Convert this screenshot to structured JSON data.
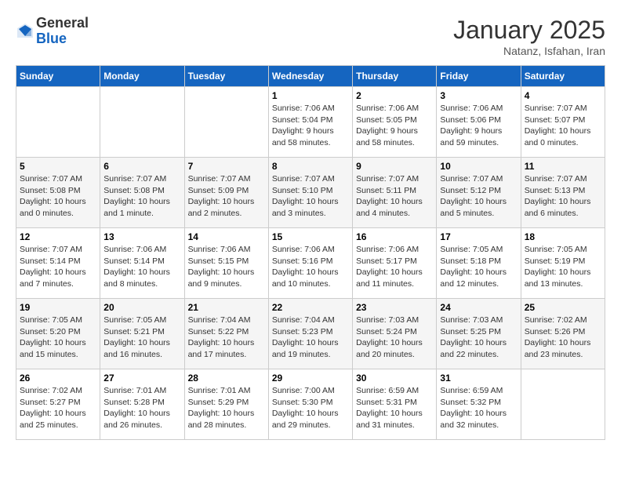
{
  "header": {
    "logo_general": "General",
    "logo_blue": "Blue",
    "month_title": "January 2025",
    "subtitle": "Natanz, Isfahan, Iran"
  },
  "days_of_week": [
    "Sunday",
    "Monday",
    "Tuesday",
    "Wednesday",
    "Thursday",
    "Friday",
    "Saturday"
  ],
  "weeks": [
    [
      {
        "day": "",
        "info": ""
      },
      {
        "day": "",
        "info": ""
      },
      {
        "day": "",
        "info": ""
      },
      {
        "day": "1",
        "info": "Sunrise: 7:06 AM\nSunset: 5:04 PM\nDaylight: 9 hours\nand 58 minutes."
      },
      {
        "day": "2",
        "info": "Sunrise: 7:06 AM\nSunset: 5:05 PM\nDaylight: 9 hours\nand 58 minutes."
      },
      {
        "day": "3",
        "info": "Sunrise: 7:06 AM\nSunset: 5:06 PM\nDaylight: 9 hours\nand 59 minutes."
      },
      {
        "day": "4",
        "info": "Sunrise: 7:07 AM\nSunset: 5:07 PM\nDaylight: 10 hours\nand 0 minutes."
      }
    ],
    [
      {
        "day": "5",
        "info": "Sunrise: 7:07 AM\nSunset: 5:08 PM\nDaylight: 10 hours\nand 0 minutes."
      },
      {
        "day": "6",
        "info": "Sunrise: 7:07 AM\nSunset: 5:08 PM\nDaylight: 10 hours\nand 1 minute."
      },
      {
        "day": "7",
        "info": "Sunrise: 7:07 AM\nSunset: 5:09 PM\nDaylight: 10 hours\nand 2 minutes."
      },
      {
        "day": "8",
        "info": "Sunrise: 7:07 AM\nSunset: 5:10 PM\nDaylight: 10 hours\nand 3 minutes."
      },
      {
        "day": "9",
        "info": "Sunrise: 7:07 AM\nSunset: 5:11 PM\nDaylight: 10 hours\nand 4 minutes."
      },
      {
        "day": "10",
        "info": "Sunrise: 7:07 AM\nSunset: 5:12 PM\nDaylight: 10 hours\nand 5 minutes."
      },
      {
        "day": "11",
        "info": "Sunrise: 7:07 AM\nSunset: 5:13 PM\nDaylight: 10 hours\nand 6 minutes."
      }
    ],
    [
      {
        "day": "12",
        "info": "Sunrise: 7:07 AM\nSunset: 5:14 PM\nDaylight: 10 hours\nand 7 minutes."
      },
      {
        "day": "13",
        "info": "Sunrise: 7:06 AM\nSunset: 5:14 PM\nDaylight: 10 hours\nand 8 minutes."
      },
      {
        "day": "14",
        "info": "Sunrise: 7:06 AM\nSunset: 5:15 PM\nDaylight: 10 hours\nand 9 minutes."
      },
      {
        "day": "15",
        "info": "Sunrise: 7:06 AM\nSunset: 5:16 PM\nDaylight: 10 hours\nand 10 minutes."
      },
      {
        "day": "16",
        "info": "Sunrise: 7:06 AM\nSunset: 5:17 PM\nDaylight: 10 hours\nand 11 minutes."
      },
      {
        "day": "17",
        "info": "Sunrise: 7:05 AM\nSunset: 5:18 PM\nDaylight: 10 hours\nand 12 minutes."
      },
      {
        "day": "18",
        "info": "Sunrise: 7:05 AM\nSunset: 5:19 PM\nDaylight: 10 hours\nand 13 minutes."
      }
    ],
    [
      {
        "day": "19",
        "info": "Sunrise: 7:05 AM\nSunset: 5:20 PM\nDaylight: 10 hours\nand 15 minutes."
      },
      {
        "day": "20",
        "info": "Sunrise: 7:05 AM\nSunset: 5:21 PM\nDaylight: 10 hours\nand 16 minutes."
      },
      {
        "day": "21",
        "info": "Sunrise: 7:04 AM\nSunset: 5:22 PM\nDaylight: 10 hours\nand 17 minutes."
      },
      {
        "day": "22",
        "info": "Sunrise: 7:04 AM\nSunset: 5:23 PM\nDaylight: 10 hours\nand 19 minutes."
      },
      {
        "day": "23",
        "info": "Sunrise: 7:03 AM\nSunset: 5:24 PM\nDaylight: 10 hours\nand 20 minutes."
      },
      {
        "day": "24",
        "info": "Sunrise: 7:03 AM\nSunset: 5:25 PM\nDaylight: 10 hours\nand 22 minutes."
      },
      {
        "day": "25",
        "info": "Sunrise: 7:02 AM\nSunset: 5:26 PM\nDaylight: 10 hours\nand 23 minutes."
      }
    ],
    [
      {
        "day": "26",
        "info": "Sunrise: 7:02 AM\nSunset: 5:27 PM\nDaylight: 10 hours\nand 25 minutes."
      },
      {
        "day": "27",
        "info": "Sunrise: 7:01 AM\nSunset: 5:28 PM\nDaylight: 10 hours\nand 26 minutes."
      },
      {
        "day": "28",
        "info": "Sunrise: 7:01 AM\nSunset: 5:29 PM\nDaylight: 10 hours\nand 28 minutes."
      },
      {
        "day": "29",
        "info": "Sunrise: 7:00 AM\nSunset: 5:30 PM\nDaylight: 10 hours\nand 29 minutes."
      },
      {
        "day": "30",
        "info": "Sunrise: 6:59 AM\nSunset: 5:31 PM\nDaylight: 10 hours\nand 31 minutes."
      },
      {
        "day": "31",
        "info": "Sunrise: 6:59 AM\nSunset: 5:32 PM\nDaylight: 10 hours\nand 32 minutes."
      },
      {
        "day": "",
        "info": ""
      }
    ]
  ]
}
